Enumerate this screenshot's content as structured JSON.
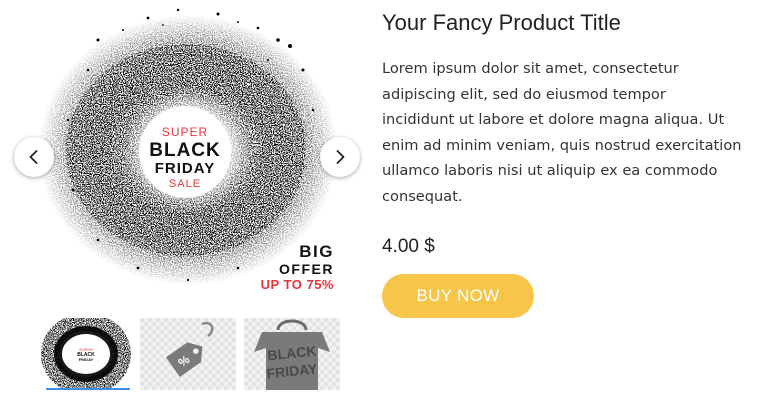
{
  "gallery": {
    "main_image": {
      "badge": {
        "line1": "SUPER",
        "line2": "BLACK",
        "line3": "FRIDAY",
        "line4": "SALE"
      },
      "promo": {
        "line1": "BIG",
        "line2": "OFFER",
        "line3": "UP TO 75%"
      }
    },
    "prev_icon": "chevron-left-icon",
    "next_icon": "chevron-right-icon",
    "thumbnails": [
      {
        "active": true
      },
      {
        "tag_text": "%"
      },
      {
        "word1": "BLACK",
        "word2": "FRIDAY"
      }
    ]
  },
  "product": {
    "title": "Your Fancy Product Title",
    "description": "Lorem ipsum dolor sit amet, consectetur adipiscing elit, sed do eiusmod tempor incididunt ut labore et dolore magna aliqua. Ut enim ad minim veniam, quis nostrud exercitation ullamco laboris nisi ut aliquip ex ea commodo consequat.",
    "price": "4.00 $",
    "buy_label": "BUY NOW"
  },
  "colors": {
    "accent": "#f7c548",
    "sale_red": "#e8333a"
  }
}
